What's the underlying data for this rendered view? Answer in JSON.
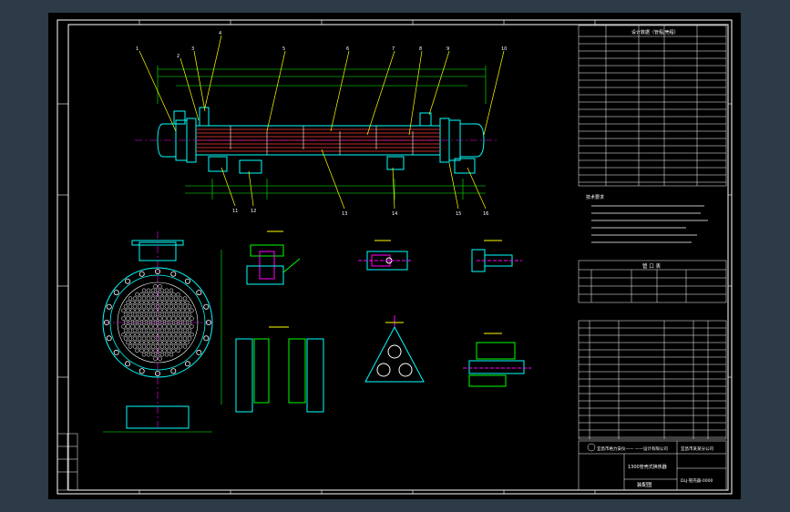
{
  "drawing": {
    "title_block": {
      "company": "宜昌市格力安仪—— ——设计有限公司",
      "drawing_name": "1300管壳式换热器",
      "sheet_type": "装配图",
      "drawing_no": "DLJ-管壳器-0000",
      "client": "宜昌市某某分公司"
    },
    "notes_heading": "技术要求",
    "nozzle_table_heading": "管 口 表",
    "spec_heading": "设计数据（管程/壳程）",
    "part_label_marks": [
      "1",
      "2",
      "3",
      "4",
      "5",
      "6",
      "7",
      "8",
      "9",
      "10",
      "11",
      "12",
      "13",
      "14",
      "15",
      "16",
      "17"
    ]
  },
  "colors": {
    "background_outer": "#2d3a47",
    "canvas": "#000000",
    "frame": "#ffffff",
    "shell": "#00ffff",
    "tubes": "#ff3b3b",
    "dimension": "#00ff00",
    "leader": "#ffff00",
    "hatch": "#ff00ff"
  }
}
